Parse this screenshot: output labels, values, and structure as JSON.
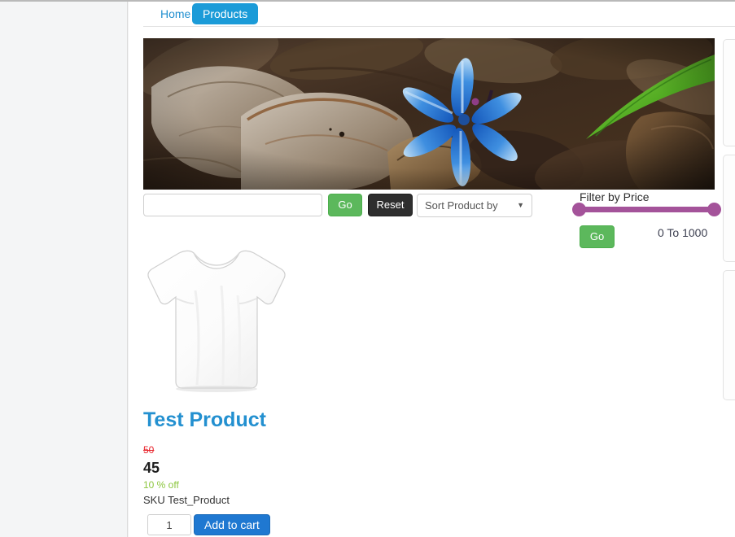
{
  "tabs": {
    "home": "Home",
    "products": "Products"
  },
  "banner": {
    "alt": "blue squill flower among dry brown leaves"
  },
  "controls": {
    "search_value": "",
    "search_placeholder": "",
    "go_label": "Go",
    "reset_label": "Reset",
    "sort_label": "Sort Product by",
    "sort_caret": "▼"
  },
  "price_filter": {
    "title": "Filter by Price",
    "go_label": "Go",
    "range_text": "0 To 1000",
    "slider_color": "#a4539a",
    "min": 0,
    "max": 1000
  },
  "product": {
    "image_alt": "white t-shirt",
    "title": "Test Product",
    "price_old": "50",
    "price_new": "45",
    "discount": "10 % off",
    "sku": "SKU Test_Product",
    "quantity": "1",
    "add_to_cart_label": "Add to cart"
  },
  "colors": {
    "tab_active_bg": "#1b9bd8",
    "link_blue": "#2390d0",
    "green_button": "#5cb85c",
    "reset_dark": "#2e2e2e",
    "cart_blue": "#1f78d1",
    "discount_green": "#8cc63e",
    "old_price_red": "#e8222a"
  }
}
